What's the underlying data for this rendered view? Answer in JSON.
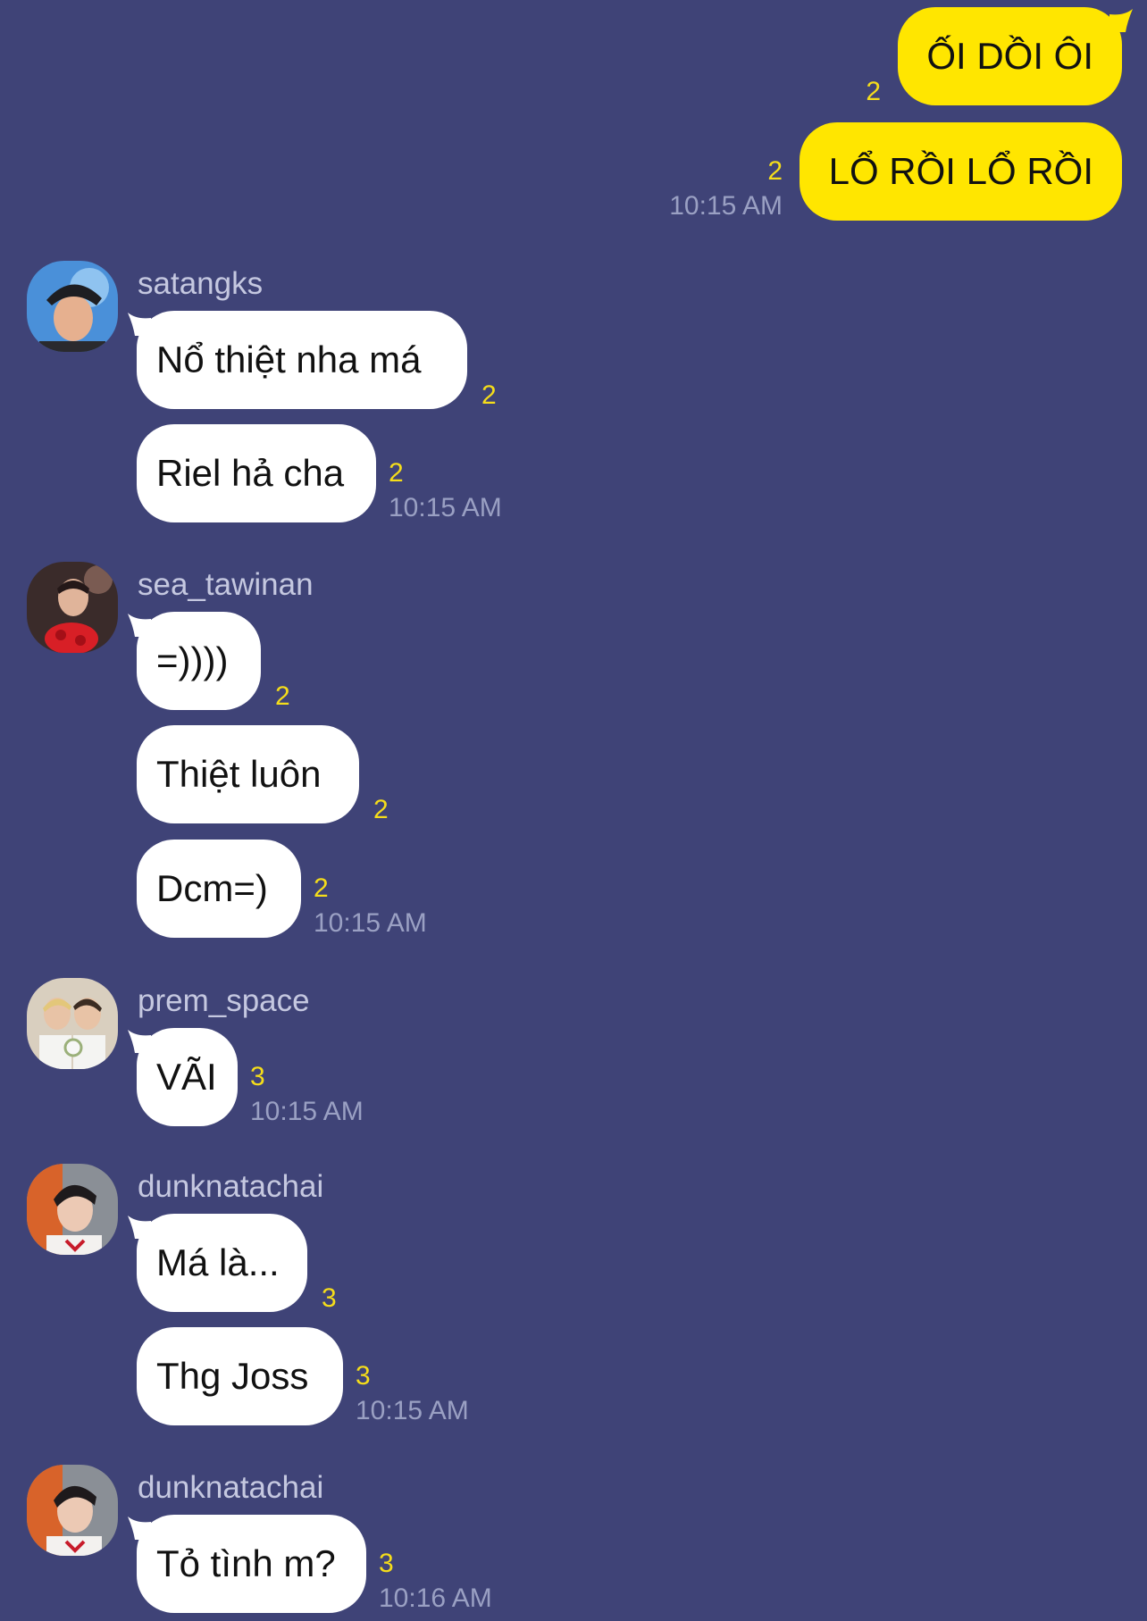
{
  "colors": {
    "background": "#3f4377",
    "outgoing_bubble": "#ffe600",
    "incoming_bubble": "#ffffff",
    "read_count": "#f5dd1a",
    "timestamp": "#9aa0c3",
    "sender_name": "#c5c8e0"
  },
  "messages": [
    {
      "dir": "out",
      "text": "ỐI DỒI ÔI",
      "read": "2",
      "time": ""
    },
    {
      "dir": "out",
      "text": "LỔ RỒI LỔ RỒI",
      "read": "2",
      "time": "10:15 AM"
    },
    {
      "dir": "in",
      "sender": "satangks",
      "avatar": "avatar-satangks",
      "text": "Nổ thiệt nha má",
      "read": "2",
      "time": ""
    },
    {
      "dir": "in",
      "text": "Riel hả cha",
      "read": "2",
      "time": "10:15 AM"
    },
    {
      "dir": "in",
      "sender": "sea_tawinan",
      "avatar": "avatar-sea-tawinan",
      "text": "=))))",
      "read": "2",
      "time": ""
    },
    {
      "dir": "in",
      "text": "Thiệt luôn",
      "read": "2",
      "time": ""
    },
    {
      "dir": "in",
      "text": "Dcm=)",
      "read": "2",
      "time": "10:15 AM"
    },
    {
      "dir": "in",
      "sender": "prem_space",
      "avatar": "avatar-prem-space",
      "text": "VÃI",
      "read": "3",
      "time": "10:15 AM"
    },
    {
      "dir": "in",
      "sender": "dunknatachai",
      "avatar": "avatar-dunknatachai",
      "text": "Má là...",
      "read": "3",
      "time": ""
    },
    {
      "dir": "in",
      "text": "Thg Joss",
      "read": "3",
      "time": "10:15 AM"
    },
    {
      "dir": "in",
      "sender": "dunknatachai",
      "avatar": "avatar-dunknatachai",
      "text": "Tỏ tình m?",
      "read": "3",
      "time": "10:16 AM"
    }
  ]
}
